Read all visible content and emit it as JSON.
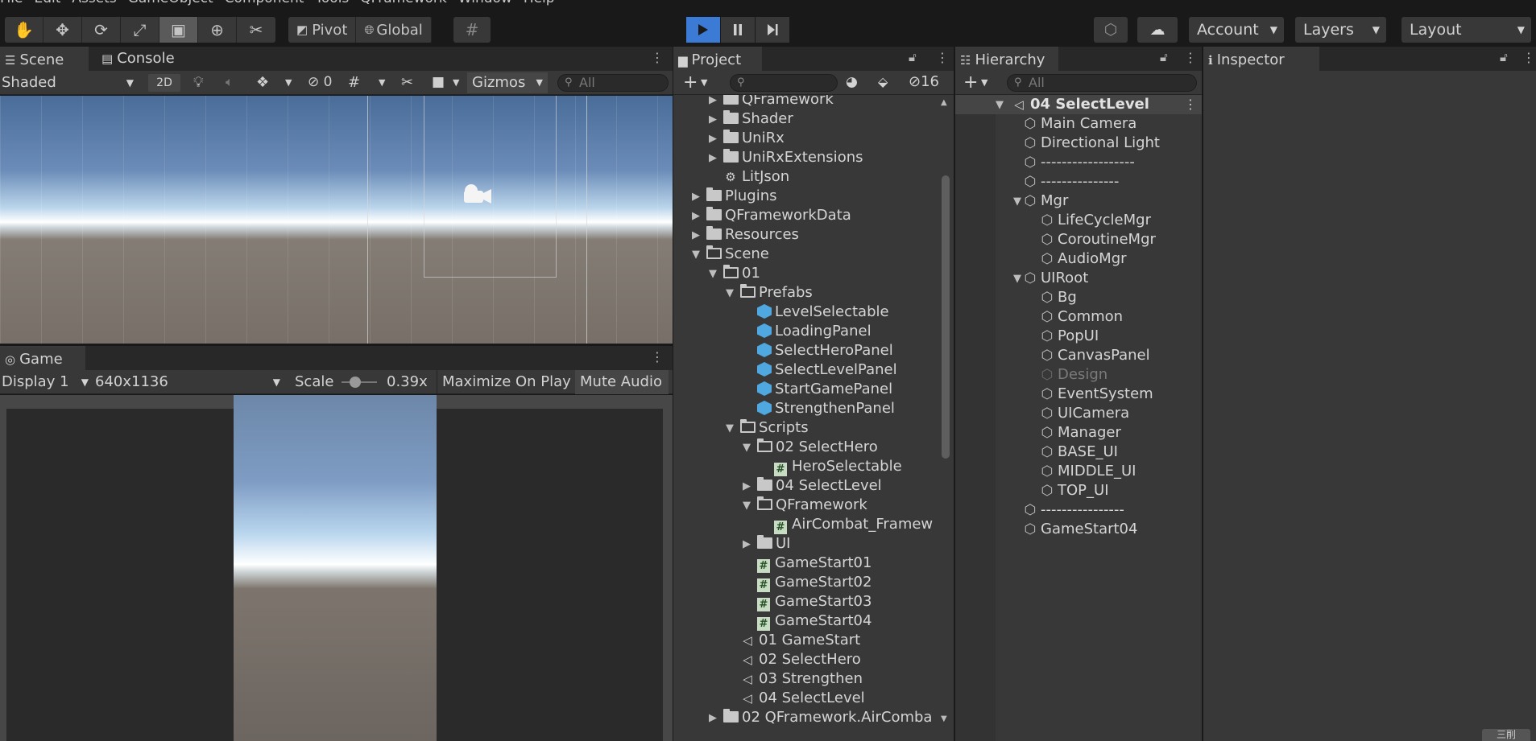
{
  "menu": [
    "File",
    "Edit",
    "Assets",
    "GameObject",
    "Component",
    "Tools",
    "QFramework",
    "Window",
    "Help"
  ],
  "toolbar": {
    "pivot": "Pivot",
    "global": "Global",
    "account": "Account",
    "layers": "Layers",
    "layout": "Layout"
  },
  "scene_panel": {
    "tab_scene": "Scene",
    "tab_console": "Console",
    "shading": "Shaded",
    "mode_2d": "2D",
    "hidden_count": "0",
    "gizmos": "Gizmos",
    "search_placeholder": "All"
  },
  "game_panel": {
    "tab": "Game",
    "display": "Display 1",
    "resolution": "640x1136",
    "scale_label": "Scale",
    "scale_value": "0.39x",
    "scale_fraction": 0.39,
    "maximize": "Maximize On Play",
    "mute": "Mute Audio"
  },
  "project_panel": {
    "tab": "Project",
    "hidden_count": "16",
    "items": [
      {
        "label": "QFramework",
        "type": "folder",
        "depth": 2,
        "arrow": "right"
      },
      {
        "label": "Shader",
        "type": "folder",
        "depth": 2,
        "arrow": "right"
      },
      {
        "label": "UniRx",
        "type": "folder",
        "depth": 2,
        "arrow": "right"
      },
      {
        "label": "UniRxExtensions",
        "type": "folder",
        "depth": 2,
        "arrow": "right"
      },
      {
        "label": "LitJson",
        "type": "plugin",
        "depth": 2,
        "arrow": ""
      },
      {
        "label": "Plugins",
        "type": "folder",
        "depth": 1,
        "arrow": "right"
      },
      {
        "label": "QFrameworkData",
        "type": "folder",
        "depth": 1,
        "arrow": "right"
      },
      {
        "label": "Resources",
        "type": "folder",
        "depth": 1,
        "arrow": "right"
      },
      {
        "label": "Scene",
        "type": "folder-open",
        "depth": 1,
        "arrow": "down"
      },
      {
        "label": "01",
        "type": "folder-open",
        "depth": 2,
        "arrow": "down"
      },
      {
        "label": "Prefabs",
        "type": "folder-open",
        "depth": 3,
        "arrow": "down"
      },
      {
        "label": "LevelSelectable",
        "type": "prefab",
        "depth": 4,
        "arrow": ""
      },
      {
        "label": "LoadingPanel",
        "type": "prefab",
        "depth": 4,
        "arrow": ""
      },
      {
        "label": "SelectHeroPanel",
        "type": "prefab",
        "depth": 4,
        "arrow": ""
      },
      {
        "label": "SelectLevelPanel",
        "type": "prefab",
        "depth": 4,
        "arrow": ""
      },
      {
        "label": "StartGamePanel",
        "type": "prefab",
        "depth": 4,
        "arrow": ""
      },
      {
        "label": "StrengthenPanel",
        "type": "prefab",
        "depth": 4,
        "arrow": ""
      },
      {
        "label": "Scripts",
        "type": "folder-open",
        "depth": 3,
        "arrow": "down"
      },
      {
        "label": "02 SelectHero",
        "type": "folder-open",
        "depth": 4,
        "arrow": "down"
      },
      {
        "label": "HeroSelectable",
        "type": "script",
        "depth": 5,
        "arrow": ""
      },
      {
        "label": "04 SelectLevel",
        "type": "folder",
        "depth": 4,
        "arrow": "right"
      },
      {
        "label": "QFramework",
        "type": "folder-open",
        "depth": 4,
        "arrow": "down"
      },
      {
        "label": "AirCombat_Framew",
        "type": "script",
        "depth": 5,
        "arrow": ""
      },
      {
        "label": "UI",
        "type": "folder",
        "depth": 4,
        "arrow": "right"
      },
      {
        "label": "GameStart01",
        "type": "script",
        "depth": 4,
        "arrow": ""
      },
      {
        "label": "GameStart02",
        "type": "script",
        "depth": 4,
        "arrow": ""
      },
      {
        "label": "GameStart03",
        "type": "script",
        "depth": 4,
        "arrow": ""
      },
      {
        "label": "GameStart04",
        "type": "script",
        "depth": 4,
        "arrow": ""
      },
      {
        "label": "01 GameStart",
        "type": "scene",
        "depth": 3,
        "arrow": ""
      },
      {
        "label": "02 SelectHero",
        "type": "scene",
        "depth": 3,
        "arrow": ""
      },
      {
        "label": "03 Strengthen",
        "type": "scene",
        "depth": 3,
        "arrow": ""
      },
      {
        "label": "04 SelectLevel",
        "type": "scene",
        "depth": 3,
        "arrow": ""
      },
      {
        "label": "02 QFramework.AirComba",
        "type": "folder",
        "depth": 2,
        "arrow": "right"
      }
    ]
  },
  "hierarchy_panel": {
    "tab": "Hierarchy",
    "search_placeholder": "All",
    "scene_name": "04 SelectLevel",
    "items": [
      {
        "label": "Main Camera",
        "depth": 1,
        "arrow": ""
      },
      {
        "label": "Directional Light",
        "depth": 1,
        "arrow": ""
      },
      {
        "label": "------------------",
        "depth": 1,
        "arrow": ""
      },
      {
        "label": "---------------",
        "depth": 1,
        "arrow": ""
      },
      {
        "label": "Mgr",
        "depth": 1,
        "arrow": "down"
      },
      {
        "label": "LifeCycleMgr",
        "depth": 2,
        "arrow": ""
      },
      {
        "label": "CoroutineMgr",
        "depth": 2,
        "arrow": ""
      },
      {
        "label": "AudioMgr",
        "depth": 2,
        "arrow": ""
      },
      {
        "label": "UIRoot",
        "depth": 1,
        "arrow": "down"
      },
      {
        "label": "Bg",
        "depth": 2,
        "arrow": ""
      },
      {
        "label": "Common",
        "depth": 2,
        "arrow": ""
      },
      {
        "label": "PopUI",
        "depth": 2,
        "arrow": ""
      },
      {
        "label": "CanvasPanel",
        "depth": 2,
        "arrow": ""
      },
      {
        "label": "Design",
        "depth": 2,
        "arrow": "",
        "inactive": true
      },
      {
        "label": "EventSystem",
        "depth": 2,
        "arrow": ""
      },
      {
        "label": "UICamera",
        "depth": 2,
        "arrow": ""
      },
      {
        "label": "Manager",
        "depth": 2,
        "arrow": ""
      },
      {
        "label": "BASE_UI",
        "depth": 2,
        "arrow": ""
      },
      {
        "label": "MIDDLE_UI",
        "depth": 2,
        "arrow": ""
      },
      {
        "label": "TOP_UI",
        "depth": 2,
        "arrow": ""
      },
      {
        "label": "----------------",
        "depth": 1,
        "arrow": ""
      },
      {
        "label": "GameStart04",
        "depth": 1,
        "arrow": ""
      }
    ]
  },
  "inspector_panel": {
    "tab": "Inspector"
  },
  "corner_badge": "三削"
}
